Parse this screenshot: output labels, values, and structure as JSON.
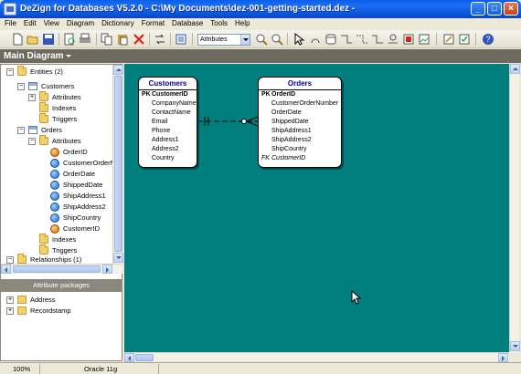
{
  "window": {
    "title": "DeZign for Databases V5.2.0 - C:\\My Documents\\dez-001-getting-started.dez -"
  },
  "menu": [
    "File",
    "Edit",
    "View",
    "Diagram",
    "Dictionary",
    "Format",
    "Database",
    "Tools",
    "Help"
  ],
  "toolbar": {
    "display_combo": "Attributes"
  },
  "document": {
    "tab_label": "Main Diagram"
  },
  "tree": {
    "entities_label": "Entities (2)",
    "customers": {
      "label": "Customers",
      "attributes": "Attributes",
      "indexes": "Indexes",
      "triggers": "Triggers"
    },
    "orders": {
      "label": "Orders",
      "attributes": "Attributes",
      "attr_list": [
        "OrderID",
        "CustomerOrderNu",
        "OrderDate",
        "ShippedDate",
        "ShipAddress1",
        "ShipAddress2",
        "ShipCountry",
        "CustomerID"
      ],
      "indexes": "Indexes",
      "triggers": "Triggers"
    },
    "relationships_label": "Relationships (1)"
  },
  "packages": {
    "header": "Attribute packages",
    "items": [
      "Address",
      "Recordstamp"
    ]
  },
  "diagram": {
    "customers": {
      "title": "Customers",
      "pk": {
        "kind": "PK",
        "name": "CustomerID"
      },
      "attrs": [
        "CompanyName",
        "ContactName",
        "Email",
        "Phone",
        "Address1",
        "Address2",
        "Country"
      ]
    },
    "orders": {
      "title": "Orders",
      "pk": {
        "kind": "PK",
        "name": "OrderID"
      },
      "attrs": [
        "CustomerOrderNumber",
        "OrderDate",
        "ShippedDate",
        "ShipAddress1",
        "ShipAddress2",
        "ShipCountry"
      ],
      "fk": {
        "kind": "FK",
        "name": "CustomerID"
      }
    }
  },
  "status": {
    "zoom": "100%",
    "dbms": "Oracle 11g"
  },
  "colors": {
    "canvas": "#017f7e",
    "title_bar": "#0a5ee8",
    "entity_title": "#00008b"
  }
}
